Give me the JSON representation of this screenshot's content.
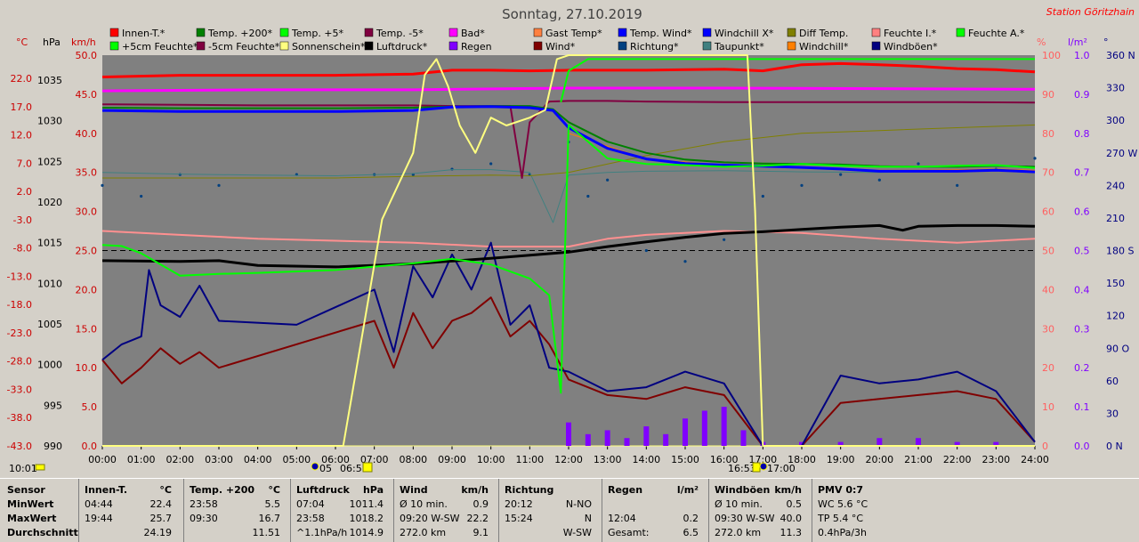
{
  "title": "Sonntag, 27.10.2019",
  "station": "Station Göritzhain",
  "colors": {
    "plot_bg": "#808080",
    "window_bg": "#d4d0c8",
    "red_axis": "#cc0000",
    "pink_axis": "#ff6060",
    "purple_axis": "#8000ff",
    "blue_axis": "#000080"
  },
  "axes": {
    "c_unit": "°C",
    "hpa_unit": "hPa",
    "kmh_unit": "km/h",
    "pct_unit": "%",
    "lm2_unit": "l/m²",
    "deg_unit": "°",
    "c_ticks": [
      "22.0",
      "17.0",
      "12.0",
      "7.0",
      "2.0",
      "-3.0",
      "-8.0",
      "-13.0",
      "-18.0",
      "-23.0",
      "-28.0",
      "-33.0",
      "-38.0",
      "-43.0"
    ],
    "hpa_ticks": [
      "1035",
      "1030",
      "1025",
      "1020",
      "1015",
      "1010",
      "1005",
      "1000",
      "995",
      "990"
    ],
    "kmh_ticks": [
      "50.0",
      "45.0",
      "40.0",
      "35.0",
      "30.0",
      "25.0",
      "20.0",
      "15.0",
      "10.0",
      "5.0",
      "0.0"
    ],
    "pct_ticks": [
      "100",
      "90",
      "80",
      "70",
      "60",
      "50",
      "40",
      "30",
      "20",
      "10",
      "0"
    ],
    "lm2_ticks": [
      "1.0",
      "0.9",
      "0.8",
      "0.7",
      "0.6",
      "0.5",
      "0.4",
      "0.3",
      "0.2",
      "0.1",
      "0.0"
    ],
    "dir_ticks": [
      "360 N",
      "330",
      "300",
      "270 W",
      "240",
      "210",
      "180 S",
      "150",
      "120",
      "90 O",
      "60",
      "30",
      "0 N"
    ],
    "x_ticks": [
      "00:00",
      "01:00",
      "02:00",
      "03:00",
      "04:00",
      "05:00",
      "06:00",
      "07:00",
      "08:00",
      "09:00",
      "10:00",
      "11:00",
      "12:00",
      "13:00",
      "14:00",
      "15:00",
      "16:00",
      "17:00",
      "18:00",
      "19:00",
      "20:00",
      "21:00",
      "22:00",
      "23:00",
      "24:00"
    ]
  },
  "sun_marks": {
    "current": "10:01",
    "rise": "06:51",
    "set": "16:53",
    "rise_prefix": "05",
    "set_suffix": "17:00"
  },
  "legend": [
    {
      "label": "Innen-T.*",
      "color": "#ff0000"
    },
    {
      "label": "Temp. +200*",
      "color": "#008000"
    },
    {
      "label": "Temp. +5*",
      "color": "#00ff00"
    },
    {
      "label": "Temp. -5*",
      "color": "#800040"
    },
    {
      "label": "Bad*",
      "color": "#ff00ff"
    },
    {
      "label": "Gast Temp*",
      "color": "#ff8040"
    },
    {
      "label": "Temp. Wind*",
      "color": "#0000ff"
    },
    {
      "label": "Windchill X*",
      "color": "#0000ff"
    },
    {
      "label": "Diff Temp.",
      "color": "#808000"
    },
    {
      "label": "Feuchte I.*",
      "color": "#ff8080"
    },
    {
      "label": "Feuchte A.*",
      "color": "#00ff00"
    },
    {
      "label": "+5cm Feuchte*",
      "color": "#00ff00"
    },
    {
      "label": "-5cm Feuchte*",
      "color": "#800040"
    },
    {
      "label": "Sonnenschein*",
      "color": "#ffff80"
    },
    {
      "label": "Luftdruck*",
      "color": "#000000"
    },
    {
      "label": "Regen",
      "color": "#8000ff"
    },
    {
      "label": "Wind*",
      "color": "#800000"
    },
    {
      "label": "Richtung*",
      "color": "#004080"
    },
    {
      "label": "Taupunkt*",
      "color": "#408080"
    },
    {
      "label": "Windchill*",
      "color": "#ff8000"
    },
    {
      "label": "Windböen*",
      "color": "#000080"
    }
  ],
  "chart_data": {
    "type": "line",
    "title": "Sonntag, 27.10.2019",
    "x_unit": "hour of day",
    "xlim": [
      0,
      24
    ],
    "grid": false,
    "legend_position": "top",
    "axes_ranges": {
      "temperature_c": [
        -43,
        27
      ],
      "pressure_hpa": [
        990,
        1040
      ],
      "wind_kmh": [
        0,
        50
      ],
      "humidity_pct": [
        0,
        100
      ],
      "rain_lm2": [
        0,
        1
      ],
      "direction_deg": [
        0,
        360
      ]
    },
    "series": [
      {
        "name": "Innen-T.*",
        "axis": "temperature_c",
        "color": "#ff0000",
        "width": 3,
        "x": [
          0,
          2,
          4,
          6,
          8,
          9,
          10,
          11,
          12,
          14,
          16,
          17,
          18,
          19,
          20,
          21,
          22,
          23,
          24
        ],
        "y": [
          23.1,
          23.4,
          23.4,
          23.4,
          23.6,
          24.3,
          24.3,
          24.2,
          24.3,
          24.3,
          24.5,
          24.2,
          25.3,
          25.5,
          25.3,
          25.0,
          24.6,
          24.4,
          24.0
        ]
      },
      {
        "name": "Bad*",
        "axis": "temperature_c",
        "color": "#ff00ff",
        "width": 3,
        "x": [
          0,
          4,
          8,
          12,
          16,
          20,
          24
        ],
        "y": [
          20.6,
          20.8,
          20.8,
          21.1,
          21.1,
          21.0,
          20.9
        ]
      },
      {
        "name": "Feuchte I.*",
        "axis": "humidity_pct",
        "color": "#ff9090",
        "width": 2,
        "x": [
          0,
          2,
          4,
          6,
          8,
          10,
          12,
          13,
          14,
          16,
          18,
          20,
          22,
          24
        ],
        "y": [
          55,
          54,
          53,
          52.5,
          52,
          51,
          51,
          53,
          54,
          55,
          54.5,
          53,
          52,
          53
        ]
      },
      {
        "name": "Luftdruck*",
        "axis": "pressure_hpa",
        "color": "#000000",
        "width": 3,
        "x": [
          0,
          2,
          3,
          4,
          6,
          8,
          10,
          12,
          13,
          14,
          15,
          16,
          17,
          18,
          19,
          20,
          20.6,
          21,
          22,
          23,
          24
        ],
        "y": [
          1013.7,
          1013.6,
          1013.7,
          1013.1,
          1012.9,
          1013.3,
          1014.0,
          1014.8,
          1015.5,
          1016.1,
          1016.7,
          1017.2,
          1017.4,
          1017.7,
          1018.0,
          1018.2,
          1017.6,
          1018.1,
          1018.2,
          1018.2,
          1018.1
        ]
      },
      {
        "name": "Taupunkt*",
        "axis": "temperature_c",
        "color": "#408080",
        "width": 1,
        "x": [
          0,
          2,
          4,
          6,
          8,
          9,
          10,
          11,
          11.6,
          12,
          13,
          14,
          16,
          18,
          20,
          22,
          24
        ],
        "y": [
          6.0,
          5.7,
          5.5,
          5.4,
          5.8,
          6.5,
          6.5,
          6.0,
          -3.0,
          5.5,
          6.0,
          6.2,
          6.3,
          6.1,
          6.0,
          6.2,
          6.4
        ]
      },
      {
        "name": "Temp. +200*",
        "axis": "temperature_c",
        "color": "#008000",
        "width": 2,
        "x": [
          0,
          2,
          4,
          6,
          8,
          9,
          10,
          11,
          11.6,
          12,
          13,
          14,
          15,
          16,
          17,
          18,
          19,
          20,
          21,
          22,
          23,
          24
        ],
        "y": [
          17.6,
          17.5,
          17.5,
          17.5,
          17.6,
          17.8,
          17.9,
          17.9,
          17.3,
          15.0,
          11.5,
          9.5,
          8.3,
          7.8,
          7.6,
          7.5,
          7.4,
          7.1,
          7.0,
          7.0,
          7.2,
          7.0
        ]
      },
      {
        "name": "Temp. Wind*",
        "axis": "temperature_c",
        "color": "#0000ff",
        "width": 3,
        "x": [
          0,
          2,
          4,
          6,
          8,
          9,
          10,
          11,
          11.6,
          12,
          13,
          14,
          15,
          16,
          17,
          18,
          19,
          20,
          21,
          22,
          23,
          24
        ],
        "y": [
          17.1,
          16.9,
          16.9,
          16.9,
          17.1,
          17.7,
          17.8,
          17.6,
          17.1,
          14.0,
          10.3,
          8.4,
          7.6,
          7.3,
          7.1,
          6.9,
          6.6,
          6.2,
          6.2,
          6.2,
          6.4,
          6.1
        ]
      },
      {
        "name": "Windchill*",
        "axis": "temperature_c",
        "color": "#ff8000",
        "width": 1,
        "x": [
          12,
          14,
          16,
          18,
          19,
          20,
          21,
          22,
          23,
          24
        ],
        "y": [
          13.0,
          8.4,
          7.3,
          6.9,
          6.5,
          6.4,
          6.4,
          6.5,
          6.6,
          6.4
        ]
      },
      {
        "name": "Temp. +5*",
        "axis": "temperature_c",
        "color": "#00ff00",
        "width": 2,
        "x": [
          0,
          0.5,
          1,
          2,
          3,
          4,
          6,
          8,
          9,
          10,
          11,
          11.5,
          11.8,
          12,
          13,
          14,
          15,
          16,
          17,
          18,
          19,
          20,
          21,
          22,
          23,
          24
        ],
        "y": [
          -7.0,
          -7.2,
          -8.5,
          -12.5,
          -12.2,
          -12.0,
          -11.5,
          -10.3,
          -9.5,
          -10.5,
          -13.0,
          -16.0,
          -33.5,
          14.5,
          8.5,
          7.5,
          7.3,
          7.0,
          7.2,
          7.5,
          7.2,
          7.0,
          7.0,
          7.2,
          7.3,
          6.8
        ]
      },
      {
        "name": "Feuchte A.*",
        "axis": "humidity_pct",
        "color": "#00ff00",
        "width": 2,
        "x": [
          11.8,
          12,
          12.5,
          14,
          16,
          17,
          18,
          20,
          22,
          24
        ],
        "y": [
          88,
          96,
          99,
          99,
          99,
          99,
          99,
          99,
          99,
          99
        ]
      },
      {
        "name": "Temp. -5*",
        "axis": "temperature_c",
        "color": "#800040",
        "width": 2,
        "x": [
          0,
          2,
          4,
          6,
          8,
          9,
          10,
          10.5,
          10.8,
          11,
          11.5,
          12,
          13,
          14,
          16,
          18,
          20,
          22,
          24
        ],
        "y": [
          18.2,
          18.1,
          18.0,
          18.0,
          18.0,
          17.9,
          17.9,
          17.9,
          5.0,
          15.0,
          18.7,
          18.8,
          18.8,
          18.7,
          18.6,
          18.6,
          18.6,
          18.6,
          18.5
        ]
      },
      {
        "name": "Diff Temp.",
        "axis": "temperature_c",
        "color": "#808000",
        "width": 1,
        "x": [
          0,
          2,
          4,
          6,
          8,
          10,
          11,
          12,
          14,
          16,
          18,
          20,
          22,
          24
        ],
        "y": [
          5.0,
          5.0,
          5.0,
          5.0,
          5.3,
          5.5,
          5.4,
          6.0,
          9.0,
          11.5,
          13.0,
          13.5,
          14.0,
          14.5
        ]
      },
      {
        "name": "Sonnenschein*",
        "axis": "humidity_pct",
        "color": "#ffff80",
        "width": 2,
        "x": [
          0,
          6.2,
          7.2,
          8.0,
          8.3,
          8.6,
          8.9,
          9.2,
          9.6,
          10.0,
          10.4,
          11.0,
          11.4,
          11.7,
          12,
          13,
          14,
          15,
          16,
          16.6,
          16.8,
          17.0,
          24
        ],
        "y": [
          0,
          0,
          58,
          75,
          95,
          99,
          92,
          82,
          75,
          84,
          82,
          84,
          86,
          99,
          100,
          100,
          100,
          100,
          100,
          100,
          60,
          0,
          0
        ]
      },
      {
        "name": "Wind*",
        "axis": "wind_kmh",
        "color": "#800000",
        "width": 2,
        "x": [
          0,
          0.5,
          1,
          1.5,
          2,
          2.5,
          3,
          7,
          7.5,
          8,
          8.5,
          9,
          9.5,
          10,
          10.5,
          11,
          11.5,
          12,
          13,
          14,
          15,
          16,
          17,
          18,
          19,
          20,
          21,
          22,
          23,
          24
        ],
        "y": [
          11.0,
          8.0,
          10.0,
          12.5,
          10.5,
          12.0,
          10.0,
          16.0,
          10.0,
          17.0,
          12.5,
          16.0,
          17.0,
          19.0,
          14.0,
          16.0,
          13.0,
          8.5,
          6.5,
          6.0,
          7.5,
          6.5,
          0.0,
          0.0,
          5.5,
          6.0,
          6.5,
          7.0,
          6.0,
          0.5
        ]
      },
      {
        "name": "Windböen*",
        "axis": "wind_kmh",
        "color": "#000080",
        "width": 2,
        "x": [
          0,
          0.5,
          1,
          1.2,
          1.5,
          2,
          2.5,
          3,
          5,
          7,
          7.5,
          8,
          8.5,
          9,
          9.5,
          10,
          10.5,
          11,
          11.5,
          12,
          13,
          14,
          15,
          16,
          17,
          18,
          19,
          20,
          21,
          22,
          23,
          24
        ],
        "y": [
          11.0,
          13.0,
          14.0,
          22.5,
          18.0,
          16.5,
          20.5,
          16.0,
          15.5,
          20.0,
          12.0,
          23.0,
          19.0,
          24.5,
          20.0,
          26.0,
          15.5,
          18.0,
          10.0,
          9.5,
          7.0,
          7.5,
          9.5,
          8.0,
          0.0,
          0.0,
          9.0,
          8.0,
          8.5,
          9.5,
          7.0,
          0.5
        ]
      },
      {
        "name": "Richtung*",
        "axis": "direction_deg",
        "color": "#004080",
        "style": "dots",
        "x": [
          0,
          1,
          2,
          3,
          5,
          7,
          8,
          9,
          10,
          11,
          12,
          12.5,
          13,
          14,
          15,
          16,
          17,
          18,
          19,
          20,
          21,
          22,
          23,
          24
        ],
        "y": [
          240,
          230,
          250,
          240,
          250,
          250,
          250,
          255,
          260,
          250,
          280,
          230,
          245,
          180,
          170,
          190,
          230,
          240,
          250,
          245,
          260,
          240,
          255,
          265
        ]
      },
      {
        "name": "Regen",
        "axis": "rain_lm2",
        "color": "#8000ff",
        "style": "bars",
        "x": [
          12,
          12.5,
          13,
          13.5,
          14,
          14.5,
          15,
          15.5,
          16,
          16.5,
          17,
          18,
          19,
          20,
          21,
          22,
          23
        ],
        "y": [
          0.06,
          0.03,
          0.04,
          0.02,
          0.05,
          0.03,
          0.07,
          0.09,
          0.1,
          0.04,
          0.01,
          0.01,
          0.01,
          0.02,
          0.02,
          0.01,
          0.01
        ]
      }
    ]
  },
  "stats": {
    "row_labels": [
      "Sensor",
      "MinWert",
      "MaxWert",
      "Durchschnitt"
    ],
    "columns": [
      {
        "title": "Innen-T.",
        "unit": "°C",
        "rows": [
          [
            "04:44",
            "22.4"
          ],
          [
            "19:44",
            "25.7"
          ],
          [
            "",
            "24.19"
          ]
        ]
      },
      {
        "title": "Temp. +200",
        "unit": "°C",
        "rows": [
          [
            "23:58",
            "5.5"
          ],
          [
            "09:30",
            "16.7"
          ],
          [
            "",
            "11.51"
          ]
        ]
      },
      {
        "title": "Luftdruck",
        "unit": "hPa",
        "rows": [
          [
            "07:04",
            "1011.4"
          ],
          [
            "23:58",
            "1018.2"
          ],
          [
            "^1.1hPa/h",
            "1014.9"
          ]
        ]
      },
      {
        "title": "Wind",
        "unit": "km/h",
        "rows": [
          [
            "Ø 10 min.",
            "0.9"
          ],
          [
            "09:20  W-SW",
            "22.2"
          ],
          [
            "272.0 km",
            "9.1"
          ]
        ]
      },
      {
        "title": "Richtung",
        "unit": "",
        "rows": [
          [
            "20:12",
            "N-NO"
          ],
          [
            "15:24",
            "N"
          ],
          [
            "",
            "W-SW"
          ]
        ]
      },
      {
        "title": "Regen",
        "unit": "l/m²",
        "rows": [
          [
            "",
            ""
          ],
          [
            "12:04",
            "0.2"
          ],
          [
            "Gesamt:",
            "6.5"
          ]
        ]
      },
      {
        "title": "Windböen",
        "unit": "km/h",
        "rows": [
          [
            "Ø 10 min.",
            "0.5"
          ],
          [
            "09:30  W-SW",
            "40.0"
          ],
          [
            "272.0 km",
            "11.3"
          ]
        ]
      },
      {
        "title": "PMV 0:7",
        "unit": "",
        "rows": [
          [
            "WC 5.6 °C",
            ""
          ],
          [
            "TP 5.4 °C",
            ""
          ],
          [
            "0.4hPa/3h",
            ""
          ]
        ]
      }
    ]
  }
}
